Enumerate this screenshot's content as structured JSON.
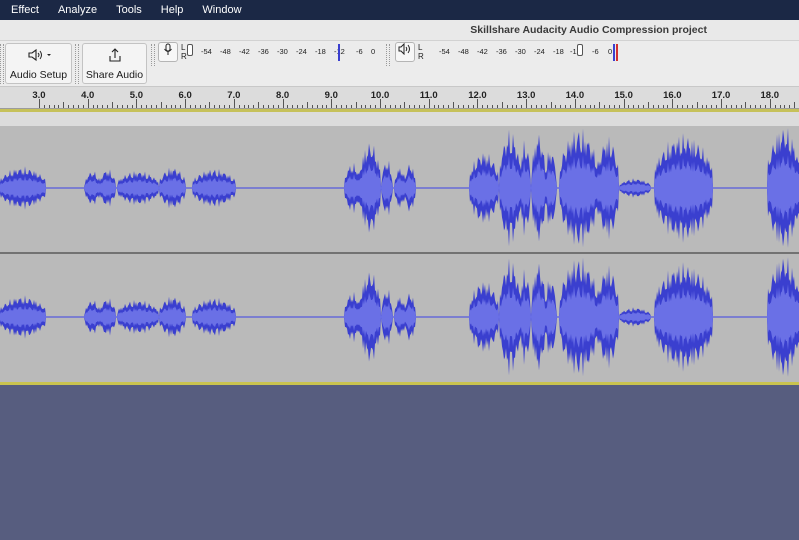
{
  "menubar": {
    "items": [
      "Effect",
      "Analyze",
      "Tools",
      "Help",
      "Window"
    ]
  },
  "window": {
    "title": "Skillshare Audacity Audio Compression project"
  },
  "toolbar": {
    "audio_setup_label": "Audio Setup",
    "audio_setup_icon": "speaker-icon",
    "share_audio_label": "Share Audio",
    "share_audio_icon": "share-icon",
    "record_meter": {
      "channel_top": "L",
      "channel_bottom": "R",
      "ticks": [
        "-54",
        "-48",
        "-42",
        "-36",
        "-30",
        "-24",
        "-18",
        "-12",
        "-6",
        "0"
      ]
    },
    "playback_meter": {
      "channel_top": "L",
      "channel_bottom": "R",
      "ticks": [
        "-54",
        "-48",
        "-42",
        "-36",
        "-30",
        "-24",
        "-18",
        "-12",
        "-6",
        "0"
      ]
    }
  },
  "ruler": {
    "labels": [
      "3.0",
      "4.0",
      "5.0",
      "6.0",
      "7.0",
      "8.0",
      "9.0",
      "10.0",
      "11.0",
      "12.0",
      "13.0",
      "14.0",
      "15.0",
      "16.0",
      "17.0",
      "18.0"
    ],
    "start": 2.2,
    "end": 18.6
  },
  "colors": {
    "menubar": "#1b2845",
    "waveform": "#3a3fcf",
    "waveform_rms": "#6a70e6",
    "track_bg": "#bababa",
    "empty_area": "#575d7f",
    "separator": "#c6c15a"
  }
}
